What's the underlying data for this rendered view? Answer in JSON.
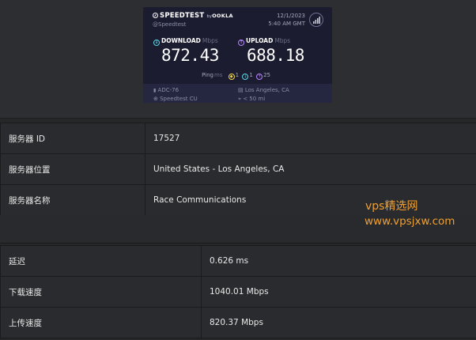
{
  "speedtest_card": {
    "brand": "SPEEDTEST",
    "by": "by",
    "brand_partner": "OOKLA",
    "handle": "@Speedtest",
    "date": "12/1/2023",
    "time": "5:40 AM GMT",
    "download_label": "DOWNLOAD",
    "download_unit": "Mbps",
    "download_value": "872.43",
    "upload_label": "UPLOAD",
    "upload_unit": "Mbps",
    "upload_value": "688.18",
    "ping_label": "Ping",
    "ping_unit": "ms",
    "ping_idle": "1",
    "ping_download": "1",
    "ping_upload": "25",
    "connection": "ADC-76",
    "provider": "Speedtest CU",
    "location": "Los Angeles, CA",
    "distance": "< 50 mi"
  },
  "server_table": [
    {
      "label": "服务器 ID",
      "value": "17527"
    },
    {
      "label": "服务器位置",
      "value": "United States - Los Angeles, CA"
    },
    {
      "label": "服务器名称",
      "value": "Race Communications"
    }
  ],
  "result_table": [
    {
      "label": "延迟",
      "value": "0.626 ms"
    },
    {
      "label": "下载速度",
      "value": "1040.01 Mbps"
    },
    {
      "label": "上传速度",
      "value": "820.37 Mbps"
    }
  ],
  "watermark": {
    "line1": "vps精选网",
    "line2": "www.vpsjxw.com"
  },
  "colors": {
    "download_accent": "#5fd6e6",
    "upload_accent": "#b786ff",
    "watermark": "#f0a030"
  }
}
